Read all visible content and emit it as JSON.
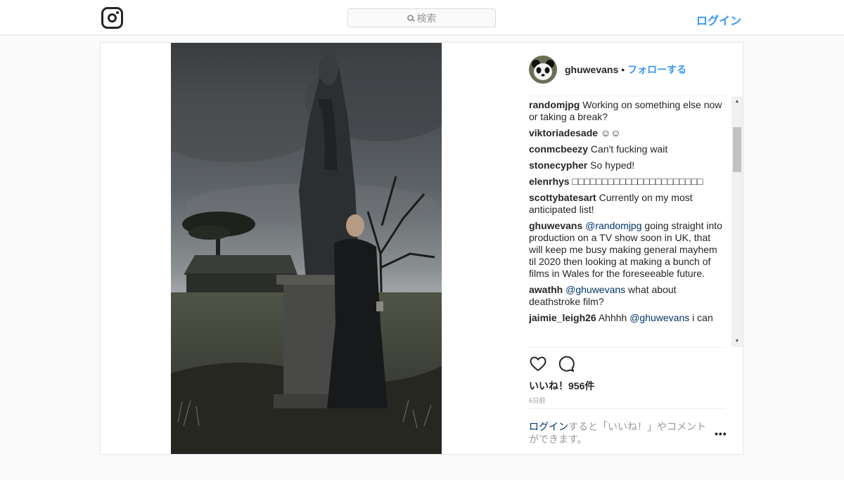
{
  "header": {
    "search_placeholder": "検索",
    "login_label": "ログイン"
  },
  "post": {
    "username": "ghuwevans",
    "bullet": "•",
    "follow_label": "フォローする",
    "comments": [
      {
        "author": "randomjpg",
        "parts": [
          {
            "text": " Working on something else now or taking a break?",
            "type": "text"
          }
        ]
      },
      {
        "author": "viktoriadesade",
        "parts": [
          {
            "text": " ☺☺",
            "type": "text"
          }
        ]
      },
      {
        "author": "conmcbeezy",
        "parts": [
          {
            "text": " Can't fucking wait",
            "type": "text"
          }
        ]
      },
      {
        "author": "stonecypher",
        "parts": [
          {
            "text": " So hyped!",
            "type": "text"
          }
        ]
      },
      {
        "author": "elenrhys",
        "parts": [
          {
            "text": " □□□□□□□□□□□□□□□□□□□□□□",
            "type": "text"
          }
        ]
      },
      {
        "author": "scottybatesart",
        "parts": [
          {
            "text": " Currently on my most anticipated list!",
            "type": "text"
          }
        ]
      },
      {
        "author": "ghuwevans",
        "parts": [
          {
            "text": " ",
            "type": "text"
          },
          {
            "text": "@randomjpg",
            "type": "mention"
          },
          {
            "text": " going straight into production on a TV show soon in UK, that will keep me busy making general mayhem til 2020 then looking at making a bunch of films in Wales for the foreseeable future.",
            "type": "text"
          }
        ]
      },
      {
        "author": "awathh",
        "parts": [
          {
            "text": " ",
            "type": "text"
          },
          {
            "text": "@ghuwevans",
            "type": "mention"
          },
          {
            "text": " what about deathstroke film?",
            "type": "text"
          }
        ]
      },
      {
        "author": "jaimie_leigh26",
        "parts": [
          {
            "text": " Ahhhh ",
            "type": "text"
          },
          {
            "text": "@ghuwevans",
            "type": "mention"
          },
          {
            "text": " i can",
            "type": "text"
          }
        ]
      }
    ],
    "likes_text": "いいね！956件",
    "time_ago": "6日前",
    "login_prompt_link": "ログイン",
    "login_prompt_rest": "すると「いいね！」やコメントができます。",
    "more_label": "•••"
  },
  "icons": {
    "logo": "instagram-logo-icon",
    "search": "search-icon",
    "like": "heart-icon",
    "comment": "comment-bubble-icon",
    "more": "more-options-icon"
  },
  "colors": {
    "accent": "#3897f0",
    "link": "#003569",
    "text": "#262626",
    "muted": "#999999"
  }
}
